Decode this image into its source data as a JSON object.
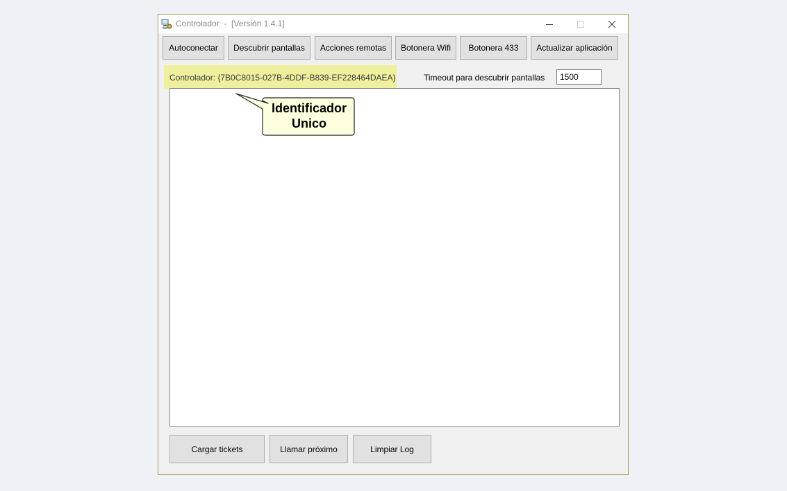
{
  "window": {
    "title": "Controlador  -  [Versión 1.4.1]",
    "icon": "app-icon"
  },
  "toolbar": {
    "buttons": [
      {
        "label": "Autoconectar"
      },
      {
        "label": "Descubrir pantallas"
      },
      {
        "label": "Acciones remotas"
      },
      {
        "label": "Botonera Wifi"
      },
      {
        "label": "Botonera 433"
      },
      {
        "label": "Actualizar aplicación"
      }
    ]
  },
  "controller": {
    "label": "Controlador: {7B0C8015-027B-4DDF-B839-EF228464DAEA}",
    "highlight_color": "#eff09d"
  },
  "timeout": {
    "label": "Timeout para descubrir pantallas",
    "value": "1500"
  },
  "callout": {
    "text": "Identificador Unico",
    "fill_color": "#ffffe0"
  },
  "bottom_buttons": [
    {
      "label": "Cargar tickets"
    },
    {
      "label": "Llamar próximo"
    },
    {
      "label": "Limpiar Log"
    }
  ]
}
